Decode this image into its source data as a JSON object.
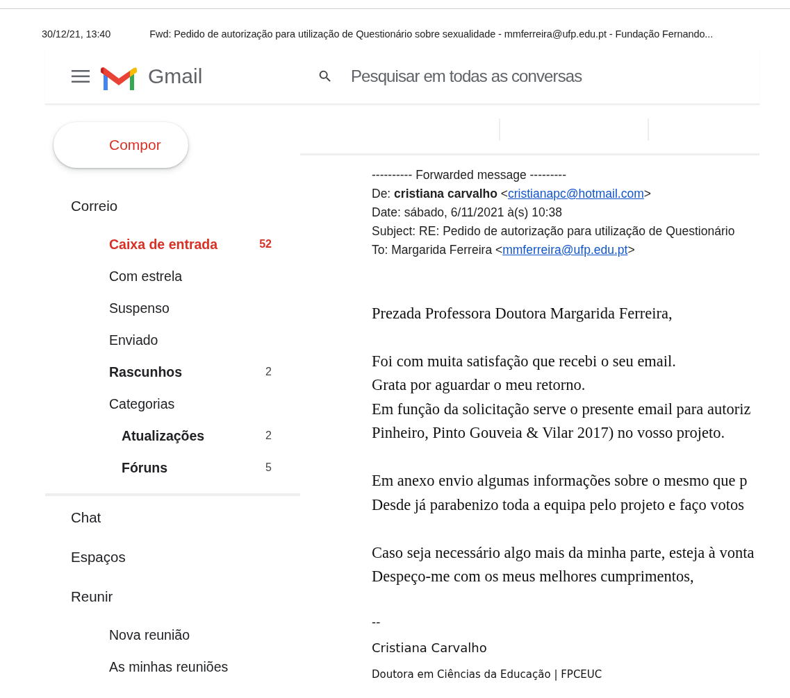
{
  "print_header": {
    "date": "30/12/21, 13:40",
    "title": "Fwd: Pedido de autorização para utilização de Questionário sobre sexualidade - mmferreira@ufp.edu.pt - Fundação Fernando..."
  },
  "app_bar": {
    "app_name": "Gmail",
    "search": {
      "placeholder": "Pesquisar em todas as conversas"
    }
  },
  "compose_button": "Compor",
  "sidebar": {
    "sections": [
      {
        "title": "Correio",
        "items": [
          {
            "label": "Caixa de entrada",
            "count": "52",
            "bold": true,
            "selected": true
          },
          {
            "label": "Com estrela",
            "bold": false,
            "selected": false
          },
          {
            "label": "Suspenso",
            "bold": false,
            "selected": false
          },
          {
            "label": "Enviado",
            "bold": false,
            "selected": false
          },
          {
            "label": "Rascunhos",
            "count": "2",
            "bold": true,
            "selected": false
          },
          {
            "label": "Categorias",
            "bold": false,
            "selected": false,
            "children": [
              {
                "label": "Atualizações",
                "count": "2",
                "bold": true,
                "selected": false
              },
              {
                "label": "Fóruns",
                "count": "5",
                "bold": true,
                "selected": false
              }
            ]
          }
        ]
      },
      {
        "title": "Chat"
      },
      {
        "title": "Espaços"
      },
      {
        "title": "Reunir",
        "items": [
          {
            "label": "Nova reunião",
            "bold": false,
            "selected": false
          },
          {
            "label": "As minhas reuniões",
            "bold": false,
            "selected": false
          }
        ]
      }
    ]
  },
  "message": {
    "forward_header": "---------- Forwarded message ---------",
    "fields": [
      {
        "text": "De: **cristiana carvalho** <",
        "link": "cristianapc@hotmail.com",
        "after": ">"
      },
      {
        "text": "Date: sábado, 6/11/2021 à(s) 10:38"
      },
      {
        "text": "Subject: RE: Pedido de autorização para utilização de Questionário"
      },
      {
        "text": "To: Margarida Ferreira <",
        "link": "mmferreira@ufp.edu.pt",
        "after": ">"
      }
    ],
    "paragraphs": [
      [
        "Prezada Professora Doutora Margarida Ferreira,"
      ],
      [
        "Foi com muita satisfação que recebi o seu email.",
        "Grata por aguardar o meu retorno.",
        "Em função da solicitação serve o presente email para autoriz",
        "Pinheiro, Pinto Gouveia & Vilar 2017) no vosso projeto."
      ],
      [
        "Em anexo envio algumas informações sobre o mesmo que p",
        "Desde já parabenizo toda a equipa pelo projeto e faço votos"
      ],
      [
        "Caso seja necessário algo mais da minha parte, esteja à vonta",
        "Despeço-me com os meus melhores cumprimentos,"
      ]
    ],
    "signature": {
      "separator": "--",
      "name": "Cristiana Carvalho",
      "title": "Doutora em Ciências da Educação | FPCEUC"
    }
  }
}
